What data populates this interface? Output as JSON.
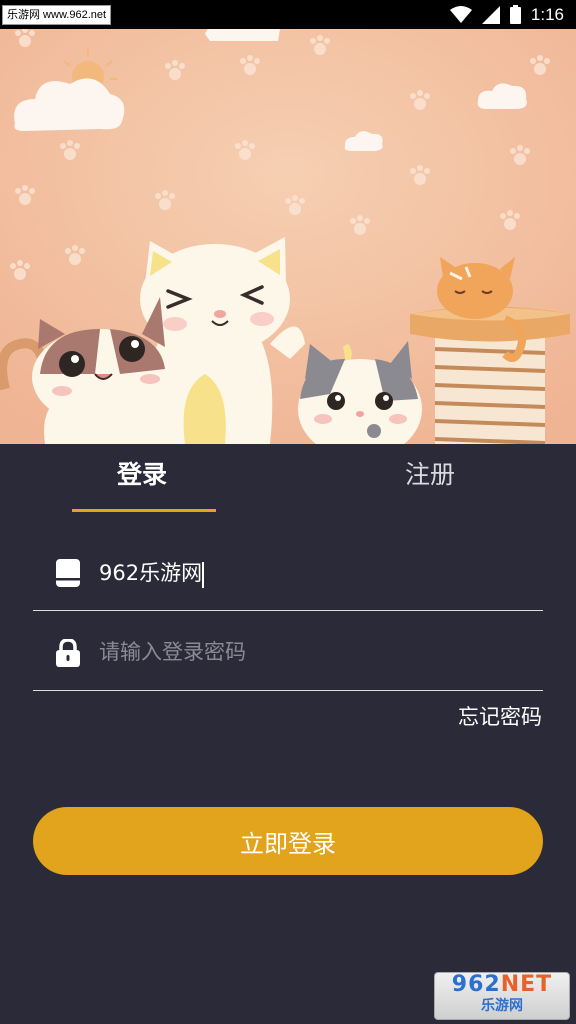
{
  "status_bar": {
    "watermark": "乐游网 www.962.net",
    "time": "1:16",
    "icons": [
      "wifi-icon",
      "cellular-signal-icon",
      "battery-icon"
    ]
  },
  "hero": {
    "description_icons": [
      "cloud-icon",
      "sun-icon",
      "paw-print-icon",
      "cat-illustration"
    ]
  },
  "tabs": {
    "login": "登录",
    "register": "注册",
    "active": "login"
  },
  "form": {
    "account_value": "962乐游网",
    "account_icon": "phone-icon",
    "password_placeholder": "请输入登录密码",
    "password_icon": "lock-icon",
    "forgot_label": "忘记密码",
    "submit_label": "立即登录"
  },
  "watermark_corner": {
    "brand_num": "962",
    "brand_suffix": "NET",
    "brand_cn": "乐游网"
  },
  "colors": {
    "background": "#2a2a38",
    "accent": "#e2a31d",
    "hero_bg": "#f3c0a0"
  }
}
